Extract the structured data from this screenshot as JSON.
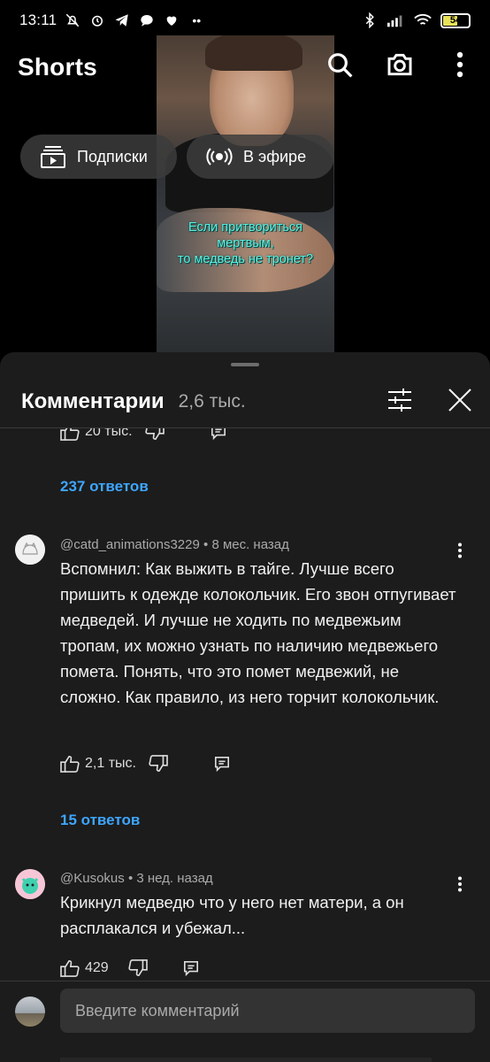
{
  "status_bar": {
    "time": "13:11",
    "battery": "54"
  },
  "header": {
    "title": "Shorts",
    "search_icon": "search-icon",
    "camera_icon": "camera-icon",
    "more_icon": "more-vert-icon"
  },
  "chips": [
    {
      "label": "Подписки",
      "icon": "subscriptions-icon"
    },
    {
      "label": "В эфире",
      "icon": "live-icon"
    }
  ],
  "video": {
    "caption_line1": "Если притвориться",
    "caption_line2": "мертвым,",
    "caption_line3": "то медведь не тронет?"
  },
  "comments_panel": {
    "title": "Комментарии",
    "count": "2,6 тыс.",
    "filter_icon": "filter-icon",
    "close_icon": "close-icon"
  },
  "partial_comment": {
    "likes": "20 тыс.",
    "replies_label": "237 ответов"
  },
  "comments": [
    {
      "author": "@catd_animations3229",
      "time": "8 мес. назад",
      "text": "Вспомнил: Как выжить в тайге. Лучше всего пришить к одежде колокольчик. Его звон отпугивает медведей. И лучше не ходить по медвежьим тропам, их можно узнать по наличию медвежьего помета. Понять, что это помет медвежий, не сложно. Как правило, из него торчит колокольчик.",
      "likes": "2,1 тыс.",
      "replies_label": "15 ответов"
    },
    {
      "author": "@Kusokus",
      "time": "3 нед. назад",
      "text": "Крикнул медведю что у него нет матери, а он расплакался и убежал...",
      "likes": "429"
    }
  ],
  "composer": {
    "placeholder": "Введите комментарий"
  },
  "colors": {
    "sheet_bg": "#1c1c1c",
    "link_blue": "#3ea6ff",
    "caption_cyan": "#5df0e0"
  }
}
